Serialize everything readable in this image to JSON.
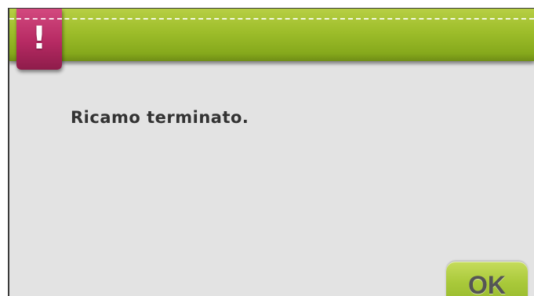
{
  "dialog": {
    "alert_icon_glyph": "!",
    "message": "Ricamo terminato.",
    "ok_label": "OK"
  },
  "colors": {
    "header_green": "#9dbd2a",
    "alert_tab_magenta": "#b62a63",
    "background_gray": "#e3e3e3",
    "message_text": "#333333",
    "button_green": "#a9c93a"
  },
  "icons": {
    "alert": "exclamation-icon"
  }
}
